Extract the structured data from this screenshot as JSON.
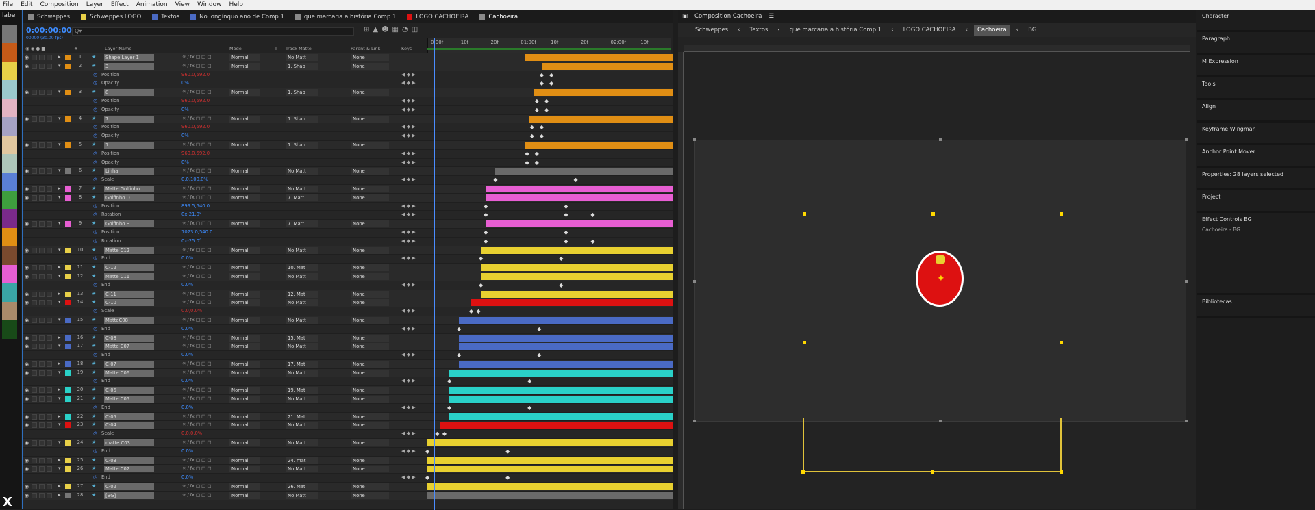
{
  "menu": [
    "File",
    "Edit",
    "Composition",
    "Layer",
    "Effect",
    "Animation",
    "View",
    "Window",
    "Help"
  ],
  "labelbar": {
    "title": "label",
    "mark": "X",
    "swatches": [
      "#777",
      "#c55a18",
      "#e8d048",
      "#9bc8cc",
      "#e3b3c3",
      "#a6a2c4",
      "#e1c79f",
      "#aec6b9",
      "#5a7fd4",
      "#3e9e3e",
      "#7a2a8a",
      "#e08e14",
      "#7a4a2e",
      "#e75ed2",
      "#3aa5a5",
      "#a98a6a",
      "#184a18"
    ]
  },
  "timeline": {
    "tabs": [
      {
        "label": "Schweppes",
        "color": "#8a8a8a"
      },
      {
        "label": "Schweppes LOGO",
        "color": "#e8d048"
      },
      {
        "label": "Textos",
        "color": "#4a6ac4"
      },
      {
        "label": "No longínquo ano de Comp 1",
        "color": "#4a6ac4"
      },
      {
        "label": "que marcaria a história Comp 1",
        "color": "#8a8a8a"
      },
      {
        "label": "LOGO CACHOEIRA",
        "color": "#d11"
      },
      {
        "label": "Cachoeira",
        "color": "#8a8a8a",
        "active": true
      }
    ],
    "timecode": "0:00:00:00",
    "timecode_sub": "00000 (30.00 fps)",
    "search_placeholder": "Q▾",
    "columns": {
      "layer_name": "Layer Name",
      "mode": "Mode",
      "t": "T",
      "track_matte": "Track Matte",
      "parent": "Parent & Link",
      "keys": "Keys"
    },
    "ruler_labels": [
      "0:00f",
      "10f",
      "20f",
      "01:00f",
      "10f",
      "20f",
      "02:00f",
      "10f"
    ],
    "rows": [
      {
        "k": "L",
        "n": "1",
        "name": "Shape Layer 1",
        "color": "#e08e14",
        "mode": "Normal",
        "tm": "No Matt",
        "parent": "None",
        "bar": {
          "s": 0.4,
          "c": "#e08e14"
        }
      },
      {
        "k": "L",
        "n": "2",
        "name": "3",
        "color": "#e08e14",
        "mode": "Normal",
        "tm": "1. Shap",
        "parent": "None",
        "open": true,
        "bar": {
          "s": 0.47,
          "c": "#e08e14"
        }
      },
      {
        "k": "P",
        "name": "Position",
        "val": "960.0,592.0",
        "red": true,
        "kfs": [
          0.47,
          0.51
        ]
      },
      {
        "k": "P",
        "name": "Opacity",
        "val": "0%",
        "kfs": [
          0.47,
          0.51
        ]
      },
      {
        "k": "L",
        "n": "3",
        "name": "8",
        "color": "#e08e14",
        "mode": "Normal",
        "tm": "1. Shap",
        "parent": "None",
        "open": true,
        "bar": {
          "s": 0.44,
          "c": "#e08e14"
        }
      },
      {
        "k": "P",
        "name": "Position",
        "val": "960.0,592.0",
        "red": true,
        "kfs": [
          0.45,
          0.49
        ]
      },
      {
        "k": "P",
        "name": "Opacity",
        "val": "0%",
        "kfs": [
          0.45,
          0.49
        ]
      },
      {
        "k": "L",
        "n": "4",
        "name": "7",
        "color": "#e08e14",
        "mode": "Normal",
        "tm": "1. Shap",
        "parent": "None",
        "open": true,
        "bar": {
          "s": 0.42,
          "c": "#e08e14"
        }
      },
      {
        "k": "P",
        "name": "Position",
        "val": "960.0,592.0",
        "red": true,
        "kfs": [
          0.43,
          0.47
        ]
      },
      {
        "k": "P",
        "name": "Opacity",
        "val": "0%",
        "kfs": [
          0.43,
          0.47
        ]
      },
      {
        "k": "L",
        "n": "5",
        "name": "1",
        "color": "#e08e14",
        "mode": "Normal",
        "tm": "1. Shap",
        "parent": "None",
        "open": true,
        "bar": {
          "s": 0.4,
          "c": "#e08e14"
        }
      },
      {
        "k": "P",
        "name": "Position",
        "val": "960.0,592.0",
        "red": true,
        "kfs": [
          0.41,
          0.45
        ]
      },
      {
        "k": "P",
        "name": "Opacity",
        "val": "0%",
        "kfs": [
          0.41,
          0.45
        ]
      },
      {
        "k": "L",
        "n": "6",
        "name": "Linha",
        "color": "#777",
        "mode": "Normal",
        "tm": "No Matt",
        "parent": "None",
        "open": true,
        "bar": {
          "s": 0.28,
          "c": "#6a6a6a"
        }
      },
      {
        "k": "P",
        "name": "Scale",
        "val": "0.0,100.0%",
        "kfs": [
          0.28,
          0.61
        ]
      },
      {
        "k": "L",
        "n": "7",
        "name": "Matte Golfinho",
        "color": "#e75ed2",
        "mode": "Normal",
        "tm": "No Matt",
        "parent": "None",
        "bar": {
          "s": 0.24,
          "c": "#e75ed2"
        }
      },
      {
        "k": "L",
        "n": "8",
        "name": "Golfinho D",
        "color": "#e75ed2",
        "mode": "Normal",
        "tm": "7. Matt",
        "parent": "None",
        "open": true,
        "bar": {
          "s": 0.24,
          "c": "#e75ed2"
        }
      },
      {
        "k": "P",
        "name": "Position",
        "val": "899.5,540.0",
        "kfs": [
          0.24,
          0.57
        ]
      },
      {
        "k": "P",
        "name": "Rotation",
        "val": "0x-21.0°",
        "kfs": [
          0.24,
          0.57,
          0.68
        ]
      },
      {
        "k": "L",
        "n": "9",
        "name": "Golfinho E",
        "color": "#e75ed2",
        "mode": "Normal",
        "tm": "7. Matt",
        "parent": "None",
        "open": true,
        "bar": {
          "s": 0.24,
          "c": "#e75ed2"
        }
      },
      {
        "k": "P",
        "name": "Position",
        "val": "1023.0,540.0",
        "kfs": [
          0.24,
          0.57
        ]
      },
      {
        "k": "P",
        "name": "Rotation",
        "val": "0x-25.0°",
        "kfs": [
          0.24,
          0.57,
          0.68
        ]
      },
      {
        "k": "L",
        "n": "10",
        "name": "Matte C12",
        "color": "#e8d048",
        "mode": "Normal",
        "tm": "No Matt",
        "parent": "None",
        "open": true,
        "bar": {
          "s": 0.22,
          "c": "#e8d030"
        }
      },
      {
        "k": "P",
        "name": "End",
        "val": "0.0%",
        "kfs": [
          0.22,
          0.55
        ]
      },
      {
        "k": "L",
        "n": "11",
        "name": "C-12",
        "color": "#e8d048",
        "mode": "Normal",
        "tm": "10. Mat",
        "parent": "None",
        "bar": {
          "s": 0.22,
          "c": "#e8d030"
        }
      },
      {
        "k": "L",
        "n": "12",
        "name": "Matte C11",
        "color": "#e8d048",
        "mode": "Normal",
        "tm": "No Matt",
        "parent": "None",
        "open": true,
        "bar": {
          "s": 0.22,
          "c": "#e8d030"
        }
      },
      {
        "k": "P",
        "name": "End",
        "val": "0.0%",
        "kfs": [
          0.22,
          0.55
        ]
      },
      {
        "k": "L",
        "n": "13",
        "name": "C-11",
        "color": "#e8d048",
        "mode": "Normal",
        "tm": "12. Mat",
        "parent": "None",
        "bar": {
          "s": 0.22,
          "c": "#e8d030"
        }
      },
      {
        "k": "L",
        "n": "14",
        "name": "C-10",
        "color": "#d11",
        "mode": "Normal",
        "tm": "No Matt",
        "parent": "None",
        "open": true,
        "bar": {
          "s": 0.18,
          "c": "#d11"
        }
      },
      {
        "k": "P",
        "name": "Scale",
        "val": "0.0,0.0%",
        "red": true,
        "kfs": [
          0.18,
          0.21
        ]
      },
      {
        "k": "L",
        "n": "15",
        "name": "MatteC08",
        "color": "#4a6ac4",
        "mode": "Normal",
        "tm": "No Matt",
        "parent": "None",
        "open": true,
        "bar": {
          "s": 0.13,
          "c": "#4a6ac4"
        }
      },
      {
        "k": "P",
        "name": "End",
        "val": "0.0%",
        "kfs": [
          0.13,
          0.46
        ]
      },
      {
        "k": "L",
        "n": "16",
        "name": "C-08",
        "color": "#4a6ac4",
        "mode": "Normal",
        "tm": "15. Mat",
        "parent": "None",
        "bar": {
          "s": 0.13,
          "c": "#4a6ac4"
        }
      },
      {
        "k": "L",
        "n": "17",
        "name": "Matte C07",
        "color": "#4a6ac4",
        "mode": "Normal",
        "tm": "No Matt",
        "parent": "None",
        "open": true,
        "bar": {
          "s": 0.13,
          "c": "#4a6ac4"
        }
      },
      {
        "k": "P",
        "name": "End",
        "val": "0.0%",
        "kfs": [
          0.13,
          0.46
        ]
      },
      {
        "k": "L",
        "n": "18",
        "name": "C-07",
        "color": "#4a6ac4",
        "mode": "Normal",
        "tm": "17. Mat",
        "parent": "None",
        "bar": {
          "s": 0.13,
          "c": "#4a6ac4"
        }
      },
      {
        "k": "L",
        "n": "19",
        "name": "Matte C06",
        "color": "#2ad1c8",
        "mode": "Normal",
        "tm": "No Matt",
        "parent": "None",
        "open": true,
        "bar": {
          "s": 0.09,
          "c": "#2ad1c8"
        }
      },
      {
        "k": "P",
        "name": "End",
        "val": "0.0%",
        "kfs": [
          0.09,
          0.42
        ]
      },
      {
        "k": "L",
        "n": "20",
        "name": "C-06",
        "color": "#2ad1c8",
        "mode": "Normal",
        "tm": "19. Mat",
        "parent": "None",
        "bar": {
          "s": 0.09,
          "c": "#2ad1c8"
        }
      },
      {
        "k": "L",
        "n": "21",
        "name": "Matte C05",
        "color": "#2ad1c8",
        "mode": "Normal",
        "tm": "No Matt",
        "parent": "None",
        "open": true,
        "bar": {
          "s": 0.09,
          "c": "#2ad1c8"
        }
      },
      {
        "k": "P",
        "name": "End",
        "val": "0.0%",
        "kfs": [
          0.09,
          0.42
        ]
      },
      {
        "k": "L",
        "n": "22",
        "name": "C-05",
        "color": "#2ad1c8",
        "mode": "Normal",
        "tm": "21. Mat",
        "parent": "None",
        "bar": {
          "s": 0.09,
          "c": "#2ad1c8"
        }
      },
      {
        "k": "L",
        "n": "23",
        "name": "C-04",
        "color": "#d11",
        "mode": "Normal",
        "tm": "No Matt",
        "parent": "None",
        "open": true,
        "bar": {
          "s": 0.05,
          "c": "#d11"
        }
      },
      {
        "k": "P",
        "name": "Scale",
        "val": "0.0,0.0%",
        "red": true,
        "kfs": [
          0.04,
          0.07
        ]
      },
      {
        "k": "L",
        "n": "24",
        "name": "matte C03",
        "color": "#e8d048",
        "mode": "Normal",
        "tm": "No Matt",
        "parent": "None",
        "open": true,
        "bar": {
          "s": 0.0,
          "c": "#e8d030"
        }
      },
      {
        "k": "P",
        "name": "End",
        "val": "0.0%",
        "kfs": [
          0.0,
          0.33
        ]
      },
      {
        "k": "L",
        "n": "25",
        "name": "C-03",
        "color": "#e8d048",
        "mode": "Normal",
        "tm": "24. mat",
        "parent": "None",
        "bar": {
          "s": 0.0,
          "c": "#e8d030"
        }
      },
      {
        "k": "L",
        "n": "26",
        "name": "Matte C02",
        "color": "#e8d048",
        "mode": "Normal",
        "tm": "No Matt",
        "parent": "None",
        "open": true,
        "bar": {
          "s": 0.0,
          "c": "#e8d030"
        }
      },
      {
        "k": "P",
        "name": "End",
        "val": "0.0%",
        "kfs": [
          0.0,
          0.33
        ]
      },
      {
        "k": "L",
        "n": "27",
        "name": "C-02",
        "color": "#e8d048",
        "mode": "Normal",
        "tm": "26. Mat",
        "parent": "None",
        "bar": {
          "s": 0.0,
          "c": "#e8d030"
        }
      },
      {
        "k": "L",
        "n": "28",
        "name": "[BG]",
        "color": "#777",
        "mode": "Normal",
        "tm": "No Matt",
        "parent": "None",
        "bar": {
          "s": 0.0,
          "c": "#6a6a6a"
        }
      }
    ]
  },
  "composition": {
    "title": "Composition Cachoeira",
    "crumbs": [
      {
        "label": "Schweppes"
      },
      {
        "label": "Textos"
      },
      {
        "label": "que marcaria a história Comp 1"
      },
      {
        "label": "LOGO CACHOEIRA"
      },
      {
        "label": "Cachoeira",
        "active": true
      },
      {
        "label": "BG"
      }
    ]
  },
  "right_panels": [
    {
      "title": "Character"
    },
    {
      "title": "Paragraph"
    },
    {
      "title": "M Expression"
    },
    {
      "title": "Tools"
    },
    {
      "title": "Align"
    },
    {
      "title": "Keyframe Wingman"
    },
    {
      "title": "Anchor Point Mover"
    },
    {
      "title": "Properties: 28 layers selected"
    },
    {
      "title": "Project"
    },
    {
      "title": "Effect Controls BG",
      "sub": "Cachoeira - BG"
    },
    {
      "title": "Bibliotecas"
    }
  ]
}
